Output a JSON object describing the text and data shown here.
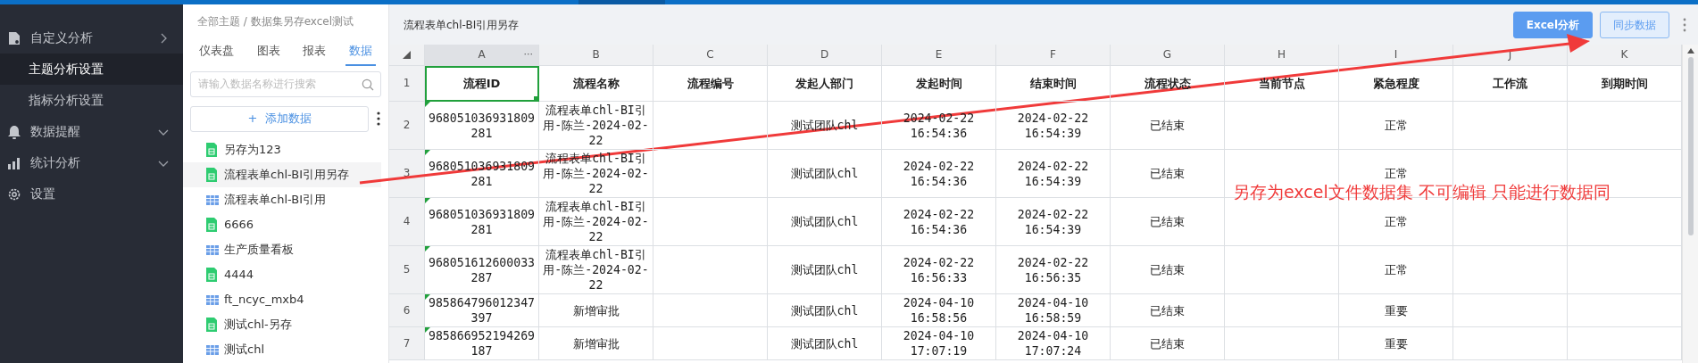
{
  "sidebar": {
    "items": [
      {
        "label": "自定义分析",
        "expanded": true,
        "selected": false,
        "children": [
          {
            "label": "主题分析设置",
            "selected": true
          },
          {
            "label": "指标分析设置",
            "selected": false
          }
        ]
      },
      {
        "label": "数据提醒",
        "expanded": false,
        "selected": false
      },
      {
        "label": "统计分析",
        "expanded": false,
        "selected": false
      },
      {
        "label": "设置",
        "selected": false
      }
    ]
  },
  "dataset_panel": {
    "breadcrumb": {
      "root": "全部主题",
      "separator": "/",
      "current": "数据集另存excel测试"
    },
    "tabs": [
      {
        "label": "仪表盘",
        "selected": false
      },
      {
        "label": "图表",
        "selected": false
      },
      {
        "label": "报表",
        "selected": false
      },
      {
        "label": "数据",
        "selected": true
      }
    ],
    "search": {
      "placeholder": "请输入数据名称进行搜索"
    },
    "add_button": {
      "icon": "+",
      "label": "添加数据"
    },
    "items": [
      {
        "label": "另存为123",
        "kind": "sheet",
        "selected": false
      },
      {
        "label": "流程表单chl-BI引用另存",
        "kind": "sheet",
        "selected": true
      },
      {
        "label": "流程表单chl-BI引用",
        "kind": "table",
        "selected": false
      },
      {
        "label": "6666",
        "kind": "sheet",
        "selected": false
      },
      {
        "label": "生产质量看板",
        "kind": "table",
        "selected": false
      },
      {
        "label": "4444",
        "kind": "sheet",
        "selected": false
      },
      {
        "label": "ft_ncyc_mxb4",
        "kind": "table",
        "selected": false
      },
      {
        "label": "测试chl-另存",
        "kind": "sheet",
        "selected": false
      },
      {
        "label": "测试chl",
        "kind": "table",
        "selected": false
      }
    ]
  },
  "header": {
    "title": "流程表单chl-BI引用另存",
    "buttons": [
      {
        "label": "Excel分析",
        "kind": "primary"
      },
      {
        "label": "同步数据",
        "kind": "outline"
      }
    ]
  },
  "sheet": {
    "columns": [
      {
        "letter": "A",
        "selected": true
      },
      {
        "letter": "B",
        "selected": false
      },
      {
        "letter": "C",
        "selected": false
      },
      {
        "letter": "D",
        "selected": false
      },
      {
        "letter": "E",
        "selected": false
      },
      {
        "letter": "F",
        "selected": false
      },
      {
        "letter": "G",
        "selected": false
      },
      {
        "letter": "H",
        "selected": false
      },
      {
        "letter": "I",
        "selected": false
      },
      {
        "letter": "J",
        "selected": false
      },
      {
        "letter": "K",
        "selected": false
      }
    ],
    "column_menu": "···",
    "rows": [
      {
        "number": "1",
        "kind": "header",
        "text_number_flag": false,
        "cells": {
          "A": "流程ID",
          "B": "流程名称",
          "C": "流程编号",
          "D": "发起人部门",
          "E": "发起时间",
          "F": "结束时间",
          "G": "流程状态",
          "H": "当前节点",
          "I": "紧急程度",
          "J": "工作流",
          "K": "到期时间"
        }
      },
      {
        "number": "2",
        "kind": "data",
        "text_number_flag": true,
        "cells": {
          "A": "968051036931809281",
          "B": "流程表单chl-BI引用-陈兰-2024-02-22",
          "D": "测试团队chl",
          "E": "2024-02-22 16:54:36",
          "F": "2024-02-22 16:54:39",
          "G": "已结束",
          "I": "正常"
        }
      },
      {
        "number": "3",
        "kind": "data",
        "text_number_flag": true,
        "cells": {
          "A": "968051036931809281",
          "B": "流程表单chl-BI引用-陈兰-2024-02-22",
          "D": "测试团队chl",
          "E": "2024-02-22 16:54:36",
          "F": "2024-02-22 16:54:39",
          "G": "已结束",
          "I": "正常"
        }
      },
      {
        "number": "4",
        "kind": "data",
        "text_number_flag": true,
        "cells": {
          "A": "968051036931809281",
          "B": "流程表单chl-BI引用-陈兰-2024-02-22",
          "D": "测试团队chl",
          "E": "2024-02-22 16:54:36",
          "F": "2024-02-22 16:54:39",
          "G": "已结束",
          "I": "正常"
        }
      },
      {
        "number": "5",
        "kind": "data",
        "text_number_flag": true,
        "cells": {
          "A": "968051612600033287",
          "B": "流程表单chl-BI引用-陈兰-2024-02-22",
          "D": "测试团队chl",
          "E": "2024-02-22 16:56:33",
          "F": "2024-02-22 16:56:35",
          "G": "已结束",
          "I": "正常"
        }
      },
      {
        "number": "6",
        "kind": "data",
        "text_number_flag": true,
        "cells": {
          "A": "985864796012347397",
          "B": "新增审批",
          "D": "测试团队chl",
          "E": "2024-04-10 16:58:56",
          "F": "2024-04-10 16:58:59",
          "G": "已结束",
          "I": "重要"
        }
      },
      {
        "number": "7",
        "kind": "data",
        "text_number_flag": true,
        "cells": {
          "A": "985866952194269187",
          "B": "新增审批",
          "D": "测试团队chl",
          "E": "2024-04-10 17:07:19",
          "F": "2024-04-10 17:07:24",
          "G": "已结束",
          "I": "重要"
        }
      }
    ]
  },
  "annotation": {
    "text": "另存为excel文件数据集 不可编辑 只能进行数据同"
  }
}
